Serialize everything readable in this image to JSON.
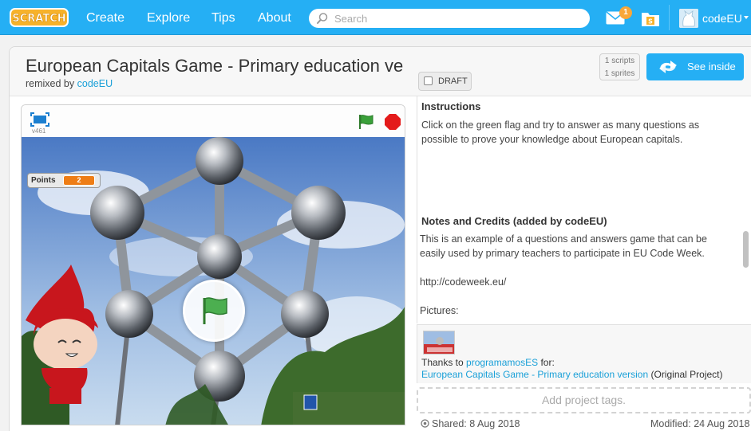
{
  "nav": {
    "logo": "SCRATCH",
    "items": [
      "Create",
      "Explore",
      "Tips",
      "About"
    ],
    "search_placeholder": "Search",
    "messages_count": "1",
    "username": "codeEU",
    "brand_color": "#25aff4"
  },
  "project": {
    "title": "European Capitals Game - Primary education ve",
    "remixed_prefix": "remixed by",
    "remixed_by": "codeEU",
    "draft_label": "DRAFT",
    "scripts_count": "1 scripts",
    "sprites_count": "1 sprites",
    "see_inside_label": "See inside"
  },
  "player": {
    "version": "v461",
    "variable_name": "Points",
    "variable_value": "2"
  },
  "description": {
    "instructions_heading": "Instructions",
    "instructions_text": "Click on the green flag and try to answer as many questions as possible to prove your knowledge about European capitals.",
    "notes_heading": "Notes and Credits (added by codeEU)",
    "notes_paragraphs": [
      "This is an example of a questions and answers game that can be easily used by primary teachers to participate in EU Code Week.",
      "http://codeweek.eu/",
      "Pictures:"
    ]
  },
  "credits": {
    "thanks_prefix": "Thanks to",
    "thanks_user": "programamosES",
    "thanks_suffix": "for:",
    "original_title": "European Capitals Game - Primary education version",
    "original_suffix": "(Original Project)"
  },
  "tags_placeholder": "Add project tags.",
  "footer": {
    "shared": "Shared: 8 Aug 2018",
    "modified": "Modified: 24 Aug 2018"
  }
}
